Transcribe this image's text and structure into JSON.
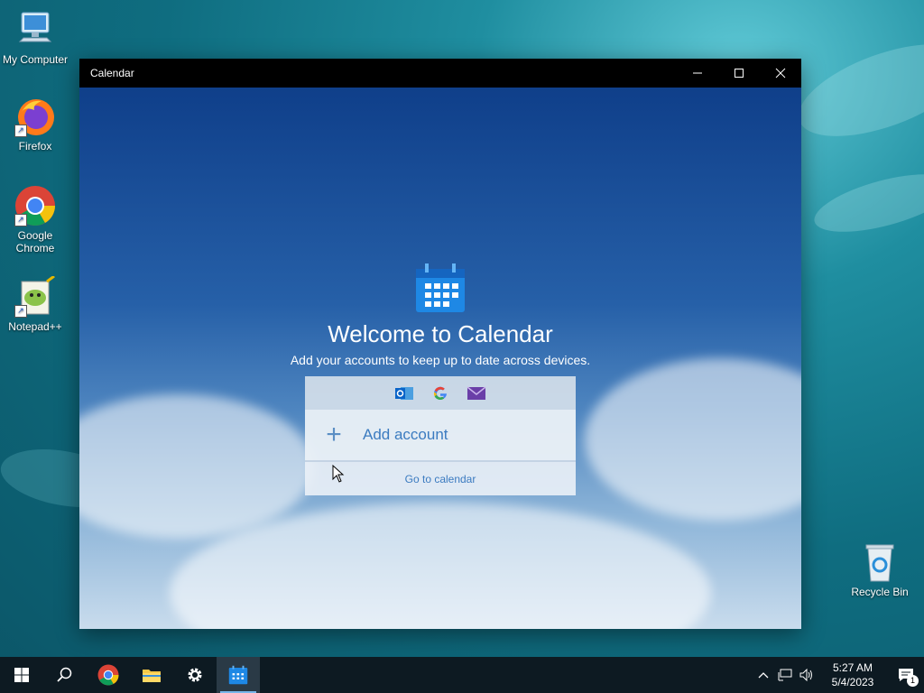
{
  "desktop": {
    "icons": [
      {
        "label": "My Computer"
      },
      {
        "label": "Firefox"
      },
      {
        "label": "Google Chrome"
      },
      {
        "label": "Notepad++"
      },
      {
        "label": "Recycle Bin"
      }
    ]
  },
  "window": {
    "title": "Calendar",
    "minimize_glyph": "—",
    "maximize_glyph": "☐",
    "close_glyph": "✕"
  },
  "welcome": {
    "heading": "Welcome to Calendar",
    "subtitle": "Add your accounts to keep up to date across devices.",
    "add_account_label": "Add account",
    "go_to_calendar_label": "Go to calendar",
    "providers": [
      "outlook-icon",
      "google-icon",
      "mail-icon"
    ]
  },
  "taskbar": {
    "time": "5:27 AM",
    "date": "5/4/2023",
    "notification_count": "1"
  },
  "colors": {
    "accent": "#3b7bc0",
    "calendar_blue": "#1e88e5",
    "taskbar": "#0d1a22"
  }
}
